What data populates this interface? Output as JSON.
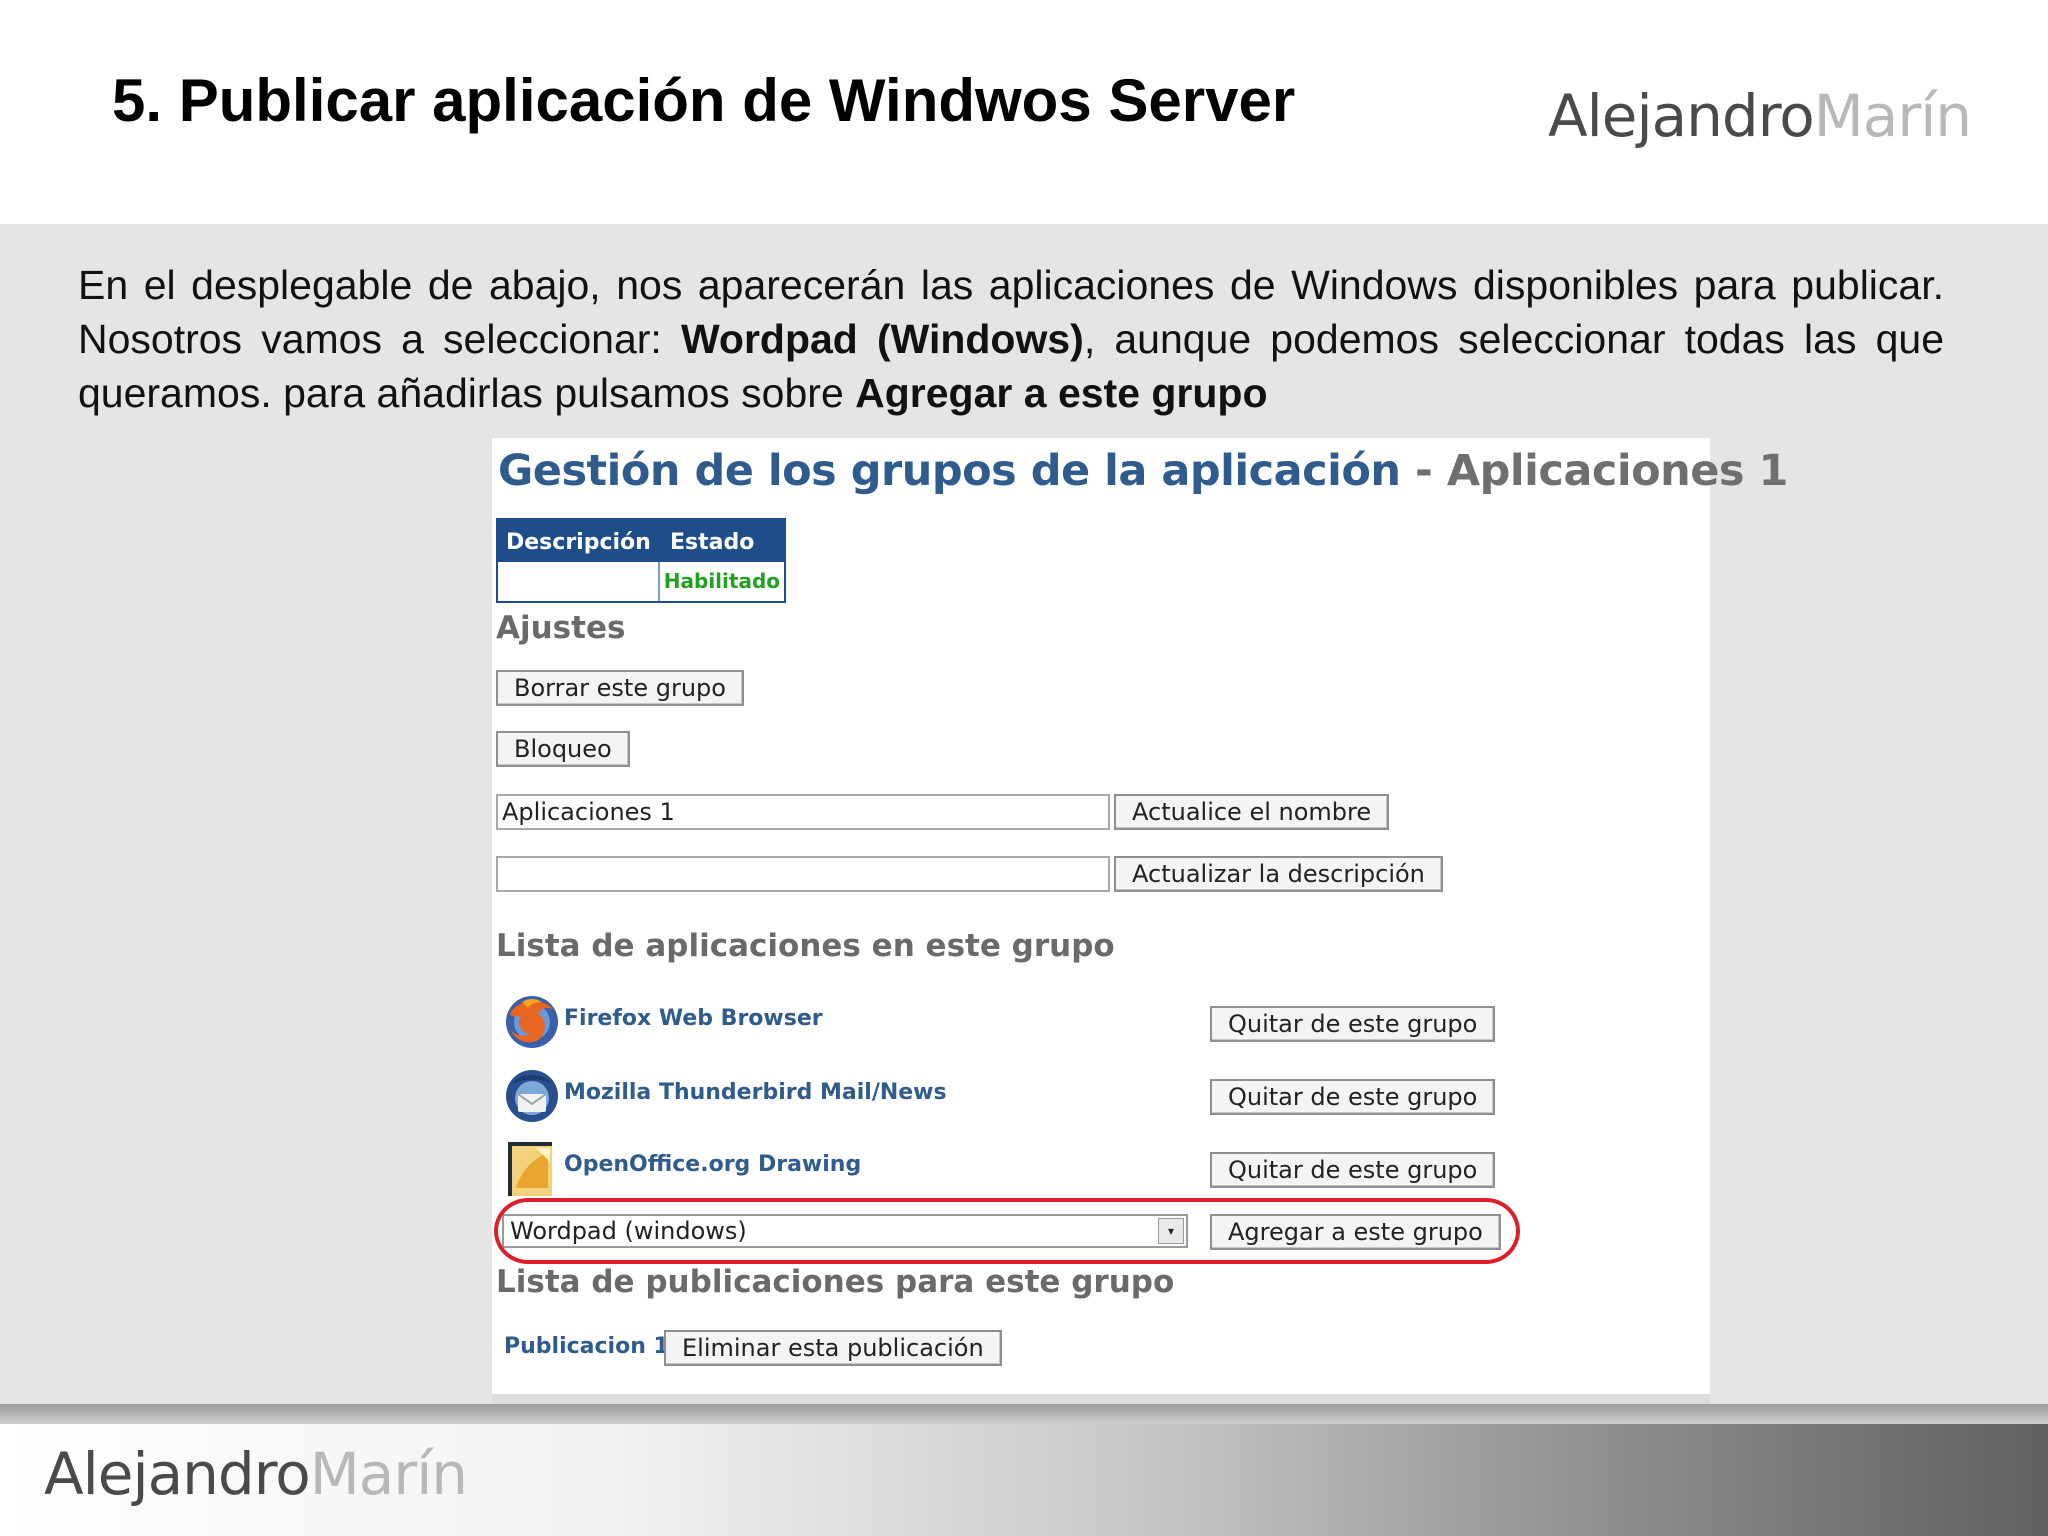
{
  "slide": {
    "title": "5. Publicar aplicación de Windwos Server",
    "logo_part1": "Alejandro",
    "logo_part2": "Marín",
    "intro_part1": "En el desplegable de abajo, nos aparecerán las aplicaciones de Windows disponibles para publicar. Nosotros vamos a seleccionar: ",
    "intro_bold1": "Wordpad (Windows)",
    "intro_part2": ", aunque podemos seleccionar todas las que queramos. para añadirlas pulsamos sobre ",
    "intro_bold2": "Agregar a este grupo"
  },
  "screenshot": {
    "title_main": "Gestión de los grupos de la aplicación",
    "title_suffix": " - Aplicaciones 1",
    "table": {
      "headers": [
        "Descripción",
        "Estado"
      ],
      "row": [
        "",
        "Habilitado"
      ]
    },
    "ajustes_heading": "Ajustes",
    "delete_group_button": "Borrar este grupo",
    "lock_button": "Bloqueo",
    "name_field_value": "Aplicaciones 1",
    "update_name_button": "Actualice el nombre",
    "description_field_value": "",
    "update_description_button": "Actualizar la descripción",
    "apps_heading": "Lista de aplicaciones en este grupo",
    "apps": [
      {
        "name": "Firefox Web Browser",
        "icon": "firefox-icon",
        "button": "Quitar de este grupo"
      },
      {
        "name": "Mozilla Thunderbird Mail/News",
        "icon": "thunderbird-icon",
        "button": "Quitar de este grupo"
      },
      {
        "name": "OpenOffice.org Drawing",
        "icon": "openoffice-draw-icon",
        "button": "Quitar de este grupo"
      }
    ],
    "app_select_value": "Wordpad (windows)",
    "add_button": "Agregar a este grupo",
    "publications_heading": "Lista de publicaciones para este grupo",
    "publication_link": "Publicacion 1",
    "delete_publication_button": "Eliminar esta publicación"
  },
  "colors": {
    "link_blue": "#2f5c8c",
    "table_header": "#1f4d8a",
    "status_green": "#22a022",
    "highlight_red": "#dd1f2c"
  }
}
